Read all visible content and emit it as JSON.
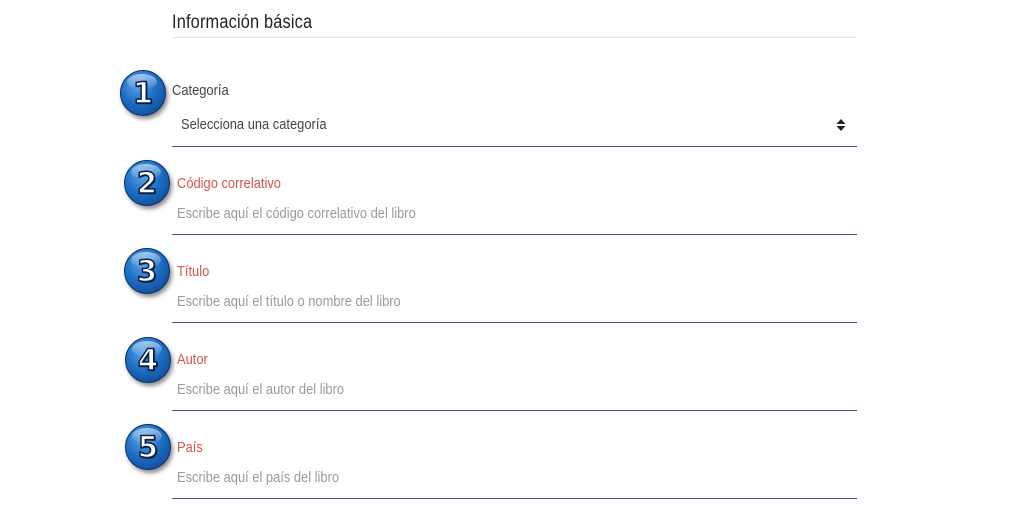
{
  "section": {
    "title": "Información básica"
  },
  "badges": [
    "1",
    "2",
    "3",
    "4",
    "5"
  ],
  "fields": {
    "categoria": {
      "label": "Categoría",
      "value": "Selecciona una categoría"
    },
    "codigo": {
      "label": "Código correlativo",
      "placeholder": "Escribe aquí el código correlativo del libro"
    },
    "titulo": {
      "label": "Título",
      "placeholder": "Escribe aquí el título o nombre del libro"
    },
    "autor": {
      "label": "Autor",
      "placeholder": "Escribe aquí el autor del libro"
    },
    "pais": {
      "label": "País",
      "placeholder": "Escribe aquí el país del libro"
    }
  },
  "colors": {
    "label_required": "#d9534f",
    "label_default": "#444444",
    "placeholder": "#9a9a9a",
    "underline": "#3a4a8a",
    "badge": "#1e6ec4"
  },
  "icons": {
    "select": "sort-arrows-icon"
  }
}
